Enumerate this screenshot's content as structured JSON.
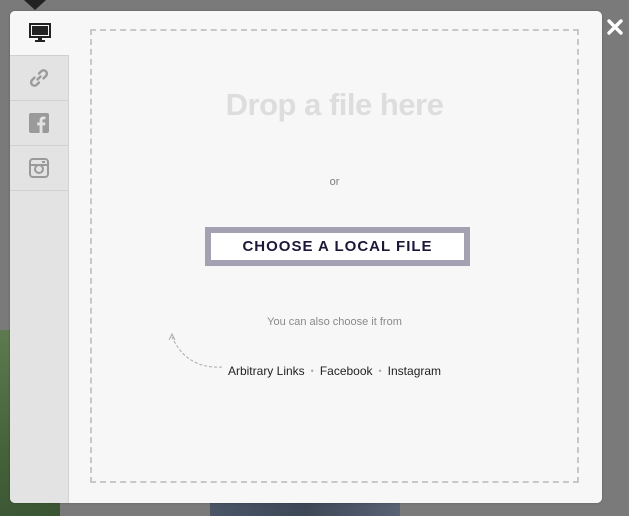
{
  "tabs": [
    {
      "icon": "monitor-icon",
      "active": true
    },
    {
      "icon": "link-icon",
      "active": false
    },
    {
      "icon": "facebook-icon",
      "active": false
    },
    {
      "icon": "instagram-icon",
      "active": false
    }
  ],
  "dropzone": {
    "title": "Drop a file here",
    "or": "or",
    "choose_label": "CHOOSE A LOCAL FILE",
    "also_text": "You can also choose it from",
    "sources": [
      {
        "label": "Arbitrary Links"
      },
      {
        "label": "Facebook"
      },
      {
        "label": "Instagram"
      }
    ]
  },
  "colors": {
    "button_border": "#a3a1b2",
    "button_text": "#1b1838",
    "title": "#dddddd"
  }
}
